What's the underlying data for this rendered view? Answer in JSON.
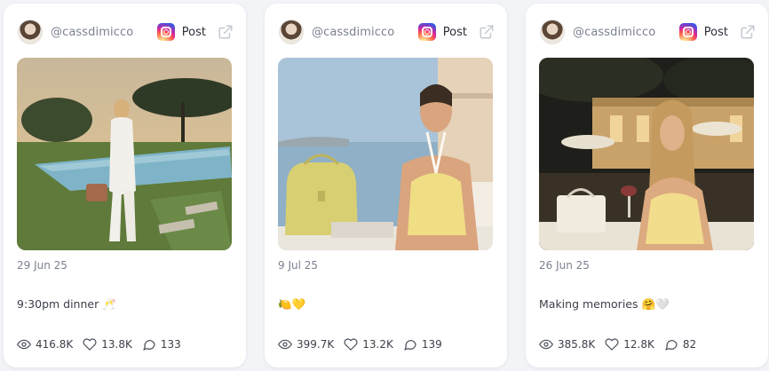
{
  "posts": [
    {
      "handle": "@cassdimicco",
      "post_label": "Post",
      "date": "29 Jun 25",
      "caption": "9:30pm dinner 🥂",
      "views": "416.8K",
      "likes": "13.8K",
      "comments": "133"
    },
    {
      "handle": "@cassdimicco",
      "post_label": "Post",
      "date": "9 Jul 25",
      "caption": "🍋💛",
      "views": "399.7K",
      "likes": "13.2K",
      "comments": "139"
    },
    {
      "handle": "@cassdimicco",
      "post_label": "Post",
      "date": "26 Jun 25",
      "caption": "Making memories 🤗🤍",
      "views": "385.8K",
      "likes": "12.8K",
      "comments": "82"
    }
  ],
  "icons": {
    "platform": "instagram-icon",
    "external": "external-link-icon",
    "views": "eye-icon",
    "likes": "heart-icon",
    "comments": "comment-icon"
  },
  "colors": {
    "page_bg": "#f2f4f7",
    "card_bg": "#ffffff",
    "muted_text": "#7b8190",
    "body_text": "#3b3f48"
  }
}
